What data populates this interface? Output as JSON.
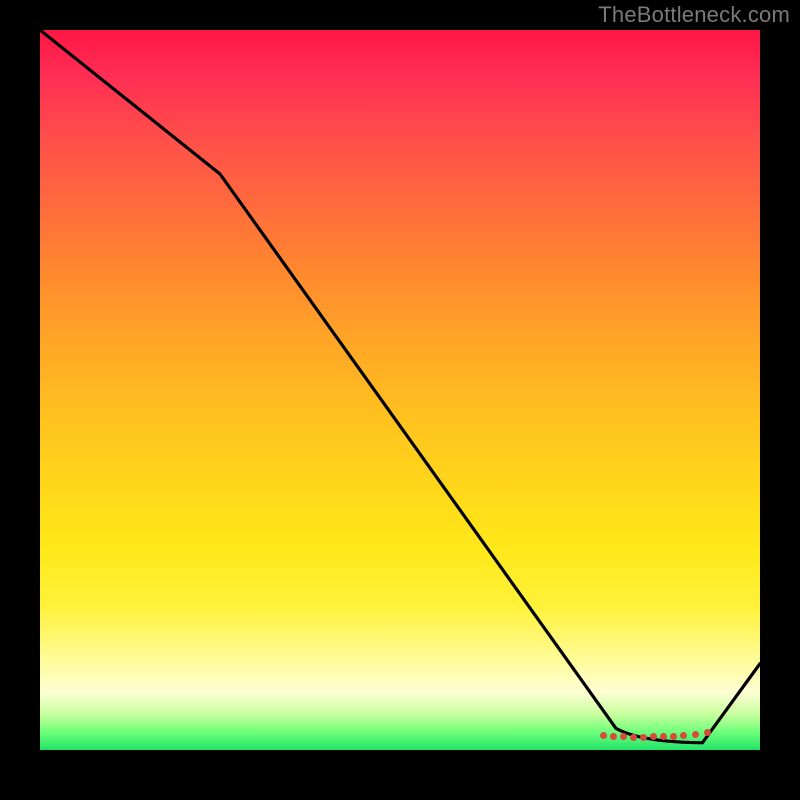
{
  "watermark": "TheBottleneck.com",
  "chart_data": {
    "type": "line",
    "title": "",
    "xlabel": "",
    "ylabel": "",
    "xlim": [
      0,
      100
    ],
    "ylim": [
      0,
      100
    ],
    "grid": false,
    "legend": false,
    "background_gradient": {
      "stops": [
        {
          "pos": 0,
          "color": "#ff1744"
        },
        {
          "pos": 50,
          "color": "#ffc21f"
        },
        {
          "pos": 80,
          "color": "#fff23a"
        },
        {
          "pos": 100,
          "color": "#22e36a"
        }
      ]
    },
    "series": [
      {
        "name": "bottleneck-curve",
        "x": [
          0,
          25,
          80,
          92,
          100
        ],
        "y": [
          100,
          80,
          3,
          1,
          12
        ],
        "color": "#000000"
      }
    ],
    "markers": {
      "name": "optimal-range",
      "x_range": [
        80,
        92
      ],
      "y": 1,
      "color": "#d84a3a"
    }
  }
}
